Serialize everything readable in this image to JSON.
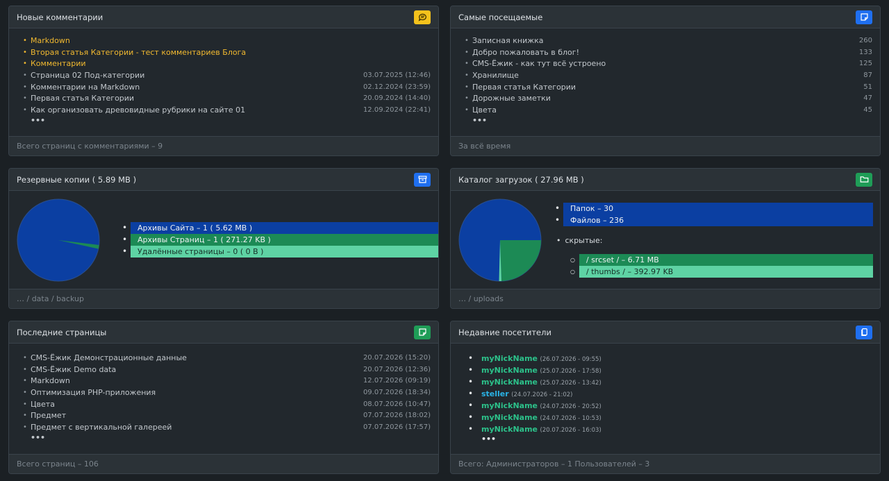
{
  "comments": {
    "title": "Новые комментарии",
    "icon": "chat-icon",
    "highlighted": [
      "Markdown",
      "Вторая статья Категории - тест комментариев Блога",
      "Комментарии"
    ],
    "items": [
      {
        "label": "Страница 02 Под-категории",
        "date": "03.07.2025 (12:46)"
      },
      {
        "label": "Комментарии на Markdown",
        "date": "02.12.2024 (23:59)"
      },
      {
        "label": "Первая статья Категории",
        "date": "20.09.2024 (14:40)"
      },
      {
        "label": "Как организовать древовидные рубрики на сайте 01",
        "date": "12.09.2024 (22:41)"
      }
    ],
    "more": "•••",
    "footer": "Всего страниц с комментариями – 9"
  },
  "popular": {
    "title": "Самые посещаемые",
    "icon": "sticky-note-icon",
    "items": [
      {
        "label": "Записная книжка",
        "count": "260"
      },
      {
        "label": "Добро пожаловать в блог!",
        "count": "133"
      },
      {
        "label": "CMS-Ёжик - как тут всё устроено",
        "count": "125"
      },
      {
        "label": "Хранилище",
        "count": "87"
      },
      {
        "label": "Первая статья Категории",
        "count": "51"
      },
      {
        "label": "Дорожные заметки",
        "count": "47"
      },
      {
        "label": "Цвета",
        "count": "45"
      }
    ],
    "more": "•••",
    "footer": "За всё время"
  },
  "backups": {
    "title": "Резервные копии  ( 5.89 MB )",
    "icon": "archive-icon",
    "legend": [
      {
        "label": "Архивы Сайта – 1  ( 5.62 MB )",
        "color": "#0b3fa2"
      },
      {
        "label": "Архивы Страниц – 1  ( 271.27 KB )",
        "color": "#1c8a55"
      },
      {
        "label": "Удалённые страницы – 0  ( 0  B )",
        "color": "#5ed3a4"
      }
    ],
    "footer": "… / data / backup"
  },
  "uploads": {
    "title": "Каталог загрузок  ( 27.96 MB )",
    "icon": "folder-icon",
    "legend": [
      {
        "label": "Папок – 30",
        "color": "#0b3fa2"
      },
      {
        "label": "Файлов – 236",
        "color": "#0b3fa2"
      }
    ],
    "hidden_label": "скрытые:",
    "hidden": [
      {
        "label": "/ srcset / – 6.71 MB",
        "color": "#1c8a55"
      },
      {
        "label": "/ thumbs / – 392.97 KB",
        "color": "#5ed3a4"
      }
    ],
    "footer": "… / uploads"
  },
  "recent_pages": {
    "title": "Последние страницы",
    "icon": "sticky-note-icon",
    "items": [
      {
        "label": "CMS-Ёжик Демонстрационные данные",
        "date": "20.07.2026 (15:20)"
      },
      {
        "label": "CMS-Ёжик Demo data",
        "date": "20.07.2026 (12:36)"
      },
      {
        "label": "Markdown",
        "date": "12.07.2026 (09:19)"
      },
      {
        "label": "Оптимизация PHP-приложения",
        "date": "09.07.2026 (18:34)"
      },
      {
        "label": "Цвета",
        "date": "08.07.2026 (10:47)"
      },
      {
        "label": "Предмет",
        "date": "07.07.2026 (18:02)"
      },
      {
        "label": "Предмет с вертикальной галереей",
        "date": "07.07.2026 (17:57)"
      }
    ],
    "more": "•••",
    "footer": "Всего страниц – 106"
  },
  "visitors": {
    "title": "Недавние посетители",
    "icon": "copy-icon",
    "items": [
      {
        "name": "myNickName",
        "date": "(26.07.2026 - 09:55)",
        "role": "user"
      },
      {
        "name": "myNickName",
        "date": "(25.07.2026 - 17:58)",
        "role": "user"
      },
      {
        "name": "myNickName",
        "date": "(25.07.2026 - 13:42)",
        "role": "user"
      },
      {
        "name": "steller",
        "date": "(24.07.2026 - 21:02)",
        "role": "admin"
      },
      {
        "name": "myNickName",
        "date": "(24.07.2026 - 20:52)",
        "role": "user"
      },
      {
        "name": "myNickName",
        "date": "(24.07.2026 - 10:53)",
        "role": "user"
      },
      {
        "name": "myNickName",
        "date": "(20.07.2026 - 16:03)",
        "role": "user"
      }
    ],
    "more": "•••",
    "footer": "Всего:  Администраторов – 1   Пользователей – 3"
  }
}
